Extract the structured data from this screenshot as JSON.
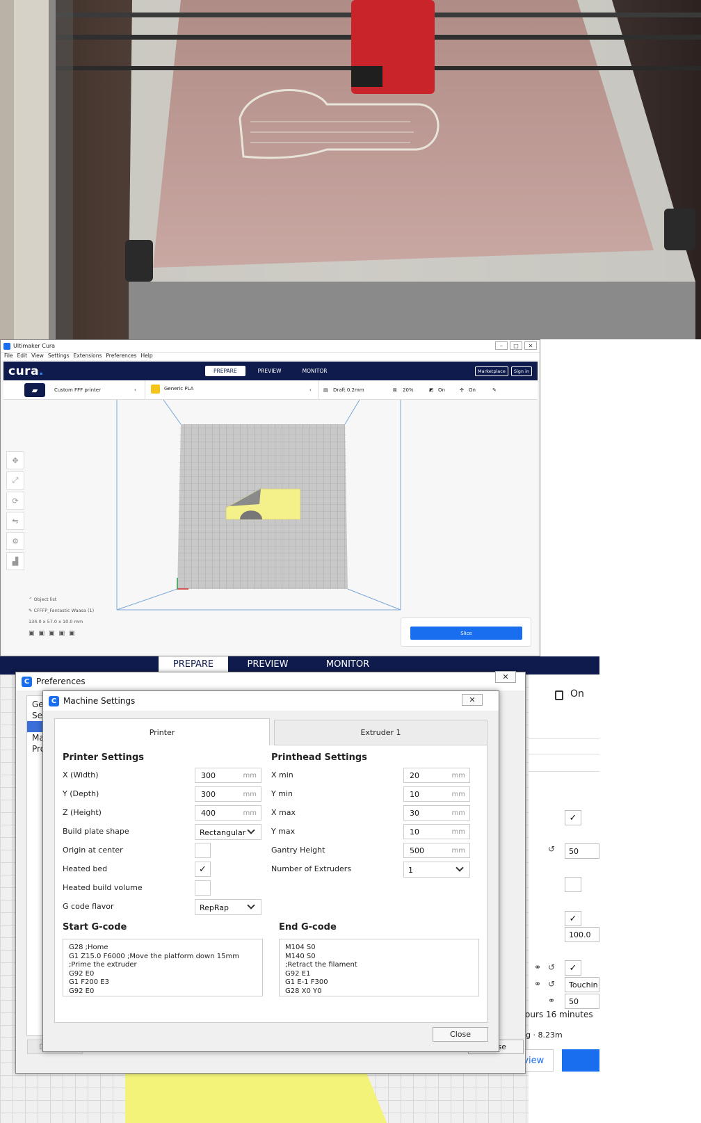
{
  "cura_window": {
    "title": "Ultimaker Cura",
    "window_controls": [
      "–",
      "□",
      "✕"
    ],
    "menu": [
      "File",
      "Edit",
      "View",
      "Settings",
      "Extensions",
      "Preferences",
      "Help"
    ],
    "brand": "cura",
    "brand_dot": ".",
    "stages": [
      "PREPARE",
      "PREVIEW",
      "MONITOR"
    ],
    "active_stage": "PREPARE",
    "marketplace_label": "Marketplace",
    "sign_in_label": "Sign in",
    "printer_name": "Custom FFF printer",
    "material_name": "Generic PLA",
    "profile_name": "Draft 0.2mm",
    "infill": "20%",
    "support": "On",
    "adhesion": "On",
    "object_list_label": "Object list",
    "object_name": "CFFFP_Fantastic Waasa (1)",
    "object_dims": "134.0 x 57.0 x 10.0 mm",
    "slice_label": "Slice"
  },
  "background": {
    "stages": [
      "PREPARE",
      "PREVIEW",
      "MONITOR"
    ],
    "support_value": "On",
    "field_values": [
      "50",
      "100.0",
      "Touchin",
      "50"
    ],
    "print_time": "ours 16 minutes",
    "print_weight": "23g · 8.23m",
    "preview_label": "Preview"
  },
  "preferences": {
    "title": "Preferences",
    "close_icon": "✕",
    "list_items": [
      "Ge",
      "Se",
      "Pr",
      "Ma",
      "Pro"
    ],
    "defaults_label": "Defaults",
    "close_label": "Close"
  },
  "machine_settings": {
    "title": "Machine Settings",
    "close_icon": "✕",
    "tabs": [
      "Printer",
      "Extruder 1"
    ],
    "printer_settings_title": "Printer Settings",
    "printhead_settings_title": "Printhead Settings",
    "x_width": {
      "label": "X (Width)",
      "value": "300",
      "unit": "mm"
    },
    "y_depth": {
      "label": "Y (Depth)",
      "value": "300",
      "unit": "mm"
    },
    "z_height": {
      "label": "Z (Height)",
      "value": "400",
      "unit": "mm"
    },
    "build_plate_shape": {
      "label": "Build plate shape",
      "value": "Rectangular"
    },
    "origin_at_center": {
      "label": "Origin at center",
      "checked": false
    },
    "heated_bed": {
      "label": "Heated bed",
      "checked": true,
      "mark": "✓"
    },
    "heated_build_volume": {
      "label": "Heated build volume",
      "checked": false
    },
    "gcode_flavor": {
      "label": "G code flavor",
      "value": "RepRap"
    },
    "x_min": {
      "label": "X min",
      "value": "20",
      "unit": "mm"
    },
    "y_min": {
      "label": "Y min",
      "value": "10",
      "unit": "mm"
    },
    "x_max": {
      "label": "X max",
      "value": "30",
      "unit": "mm"
    },
    "y_max": {
      "label": "Y max",
      "value": "10",
      "unit": "mm"
    },
    "gantry_height": {
      "label": "Gantry Height",
      "value": "500",
      "unit": "mm"
    },
    "number_of_extruders": {
      "label": "Number of Extruders",
      "value": "1"
    },
    "start_gcode_title": "Start G-code",
    "end_gcode_title": "End G-code",
    "start_gcode": "G28 ;Home\nG1 Z15.0 F6000 ;Move the platform down 15mm\n;Prime the extruder\nG92 E0\nG1 F200 E3\nG92 E0",
    "end_gcode": "M104 S0\nM140 S0\n;Retract the filament\nG92 E1\nG1 E-1 F300\nG28 X0 Y0",
    "close_label": "Close"
  }
}
